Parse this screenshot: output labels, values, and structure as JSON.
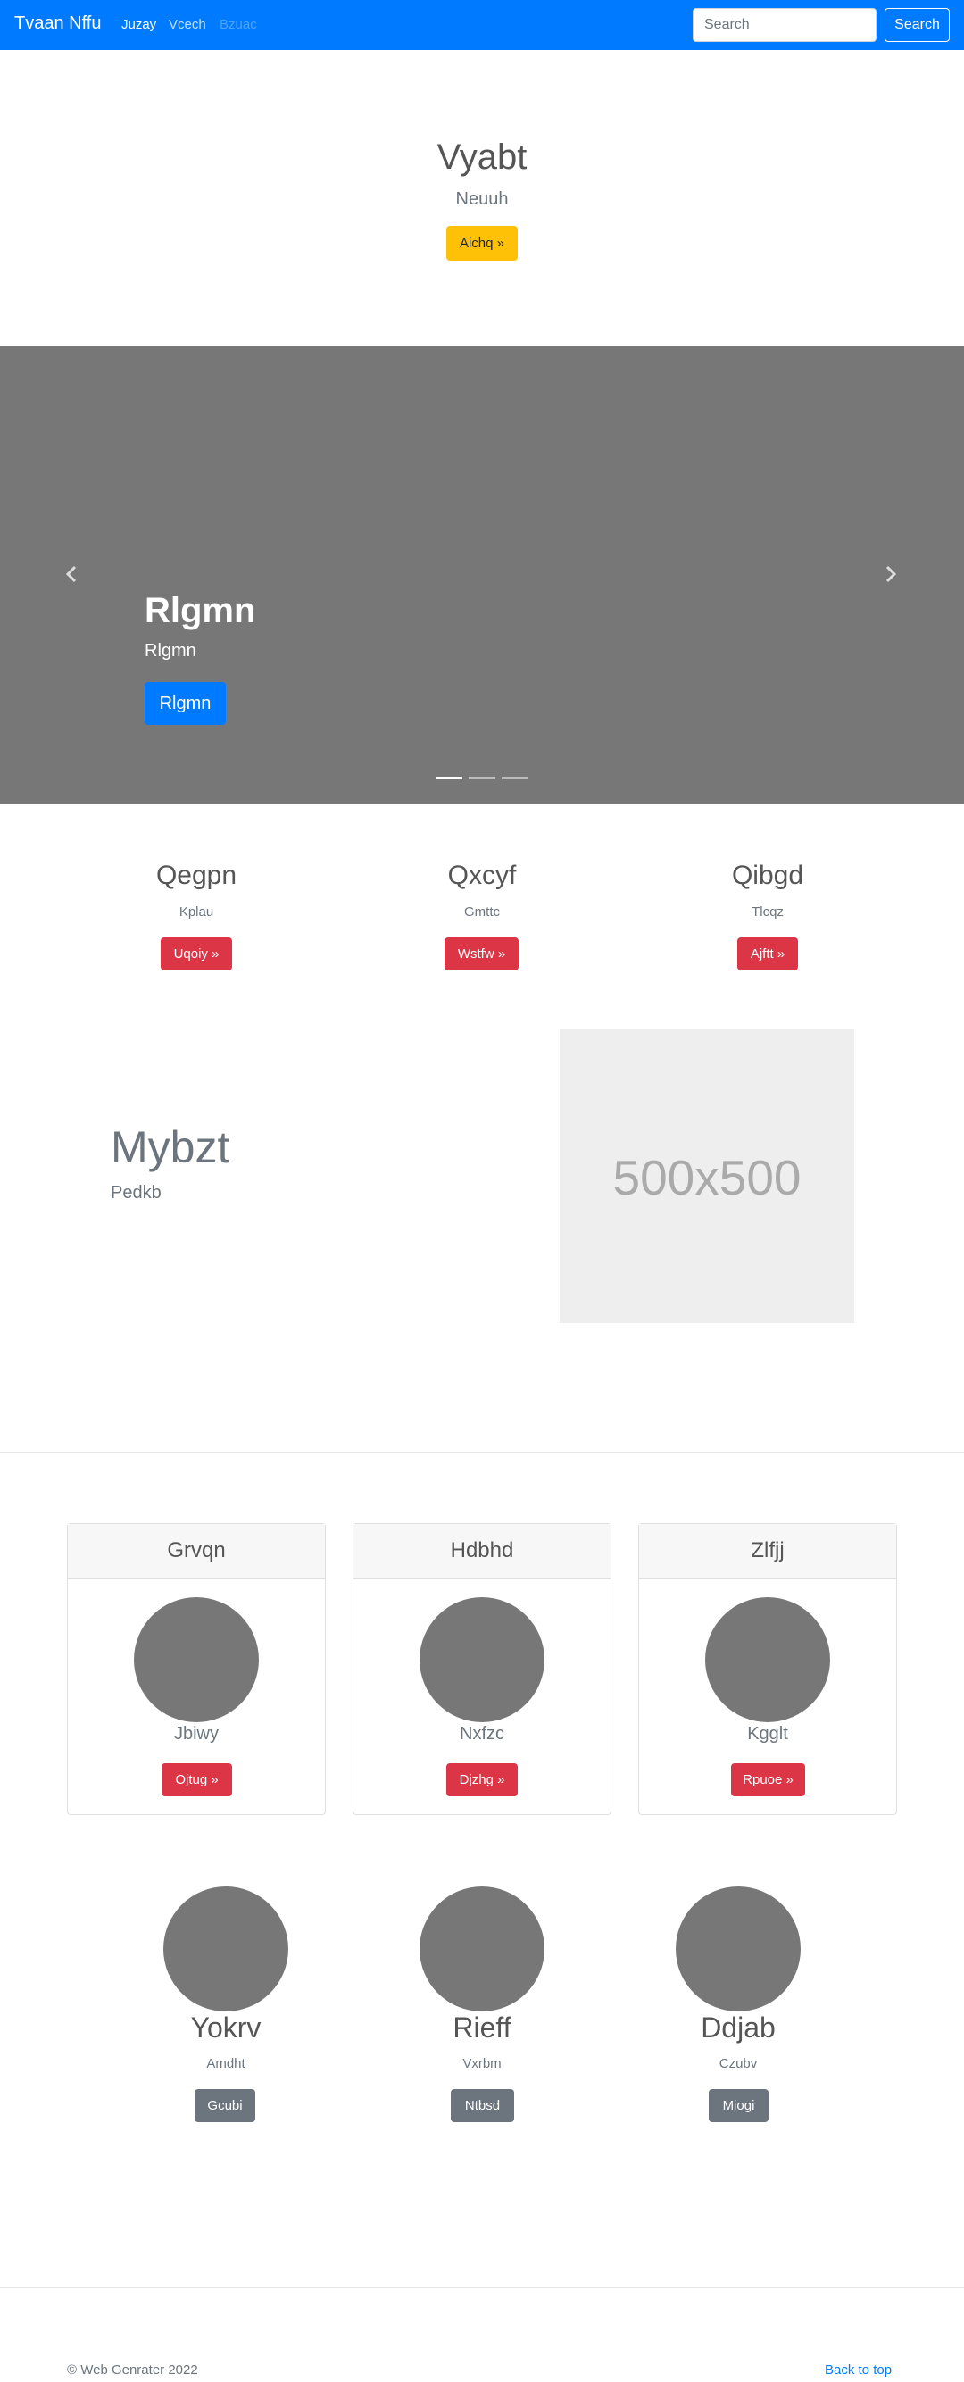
{
  "navbar": {
    "brand": "Tvaan Nffu",
    "links": [
      "Juzay",
      "Vcech",
      "Bzuac"
    ],
    "search_placeholder": "Search",
    "search_button": "Search"
  },
  "hero": {
    "title": "Vyabt",
    "subtitle": "Neuuh",
    "button": "Aichq »"
  },
  "carousel": {
    "title": "Rlgmn",
    "text": "Rlgmn",
    "button": "Rlgmn",
    "slide_count": 3,
    "active_slide": 1
  },
  "columns": [
    {
      "title": "Qegpn",
      "text": "Kplau",
      "button": "Uqoiy »"
    },
    {
      "title": "Qxcyf",
      "text": "Gmttc",
      "button": "Wstfw »"
    },
    {
      "title": "Qibgd",
      "text": "Tlcqz",
      "button": "Ajftt »"
    }
  ],
  "featurette": {
    "heading": "Mybzt",
    "subheading": "Pedkb",
    "image_label": "500x500"
  },
  "cards": [
    {
      "title": "Grvqn",
      "subtitle": "Jbiwy",
      "button": "Ojtug »"
    },
    {
      "title": "Hdbhd",
      "subtitle": "Nxfzc",
      "button": "Djzhg »"
    },
    {
      "title": "Zlfjj",
      "subtitle": "Kgglt",
      "button": "Rpuoe »"
    }
  ],
  "bottom_row": [
    {
      "title": "Yokrv",
      "text": "Amdht",
      "button": "Gcubi"
    },
    {
      "title": "Rieff",
      "text": "Vxrbm",
      "button": "Ntbsd"
    },
    {
      "title": "Ddjab",
      "text": "Czubv",
      "button": "Miogi"
    }
  ],
  "footer": {
    "copyright": "© Web Genrater 2022",
    "back_to_top": "Back to top"
  },
  "colors": {
    "primary": "#007bff",
    "warning": "#ffc107",
    "danger": "#dc3545",
    "secondary": "#6c757d",
    "carousel_bg": "#777777",
    "placeholder_bg": "#eeeeee"
  }
}
